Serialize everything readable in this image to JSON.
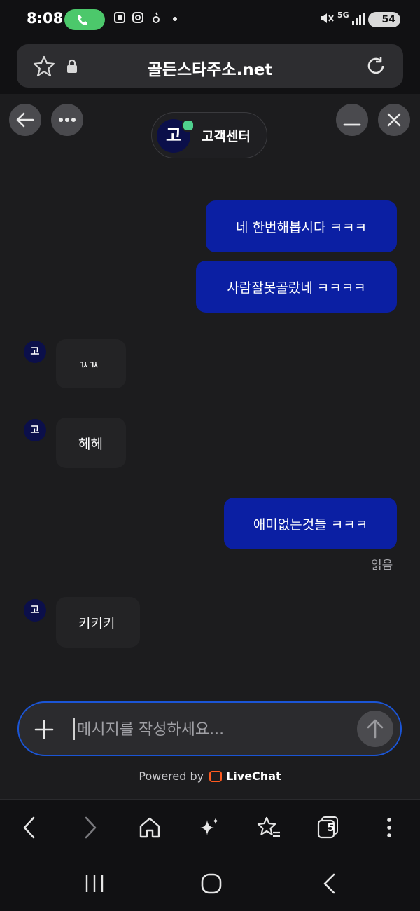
{
  "status_bar": {
    "time": "8:08",
    "network": "5G",
    "battery": "54"
  },
  "browser": {
    "url": "골든스타주소.net"
  },
  "chat": {
    "agent_initial": "고",
    "agent_name": "고객센터",
    "messages": [
      {
        "dir": "out",
        "text": "네 한번해봅시다 ㅋㅋㅋ"
      },
      {
        "dir": "out",
        "text": "사람잘못골랐네 ㅋㅋㅋㅋ"
      },
      {
        "dir": "in",
        "avatar": "고",
        "text": "ㄳㄳ"
      },
      {
        "dir": "in",
        "avatar": "고",
        "text": "헤헤"
      },
      {
        "dir": "out",
        "text": "애미없는것들 ㅋㅋㅋ"
      },
      {
        "dir": "in",
        "avatar": "고",
        "text": "키키키"
      }
    ],
    "read_status": "읽음"
  },
  "composer": {
    "placeholder": "메시지를 작성하세요...",
    "powered_prefix": "Powered by",
    "powered_brand": "LiveChat"
  },
  "toolbar": {
    "tab_count": "5"
  },
  "colors": {
    "outgoing_bubble": "#0b1fa3",
    "accent_border": "#1b55d6",
    "online_dot": "#4fd08f",
    "livechat_orange": "#ff5a1f"
  }
}
